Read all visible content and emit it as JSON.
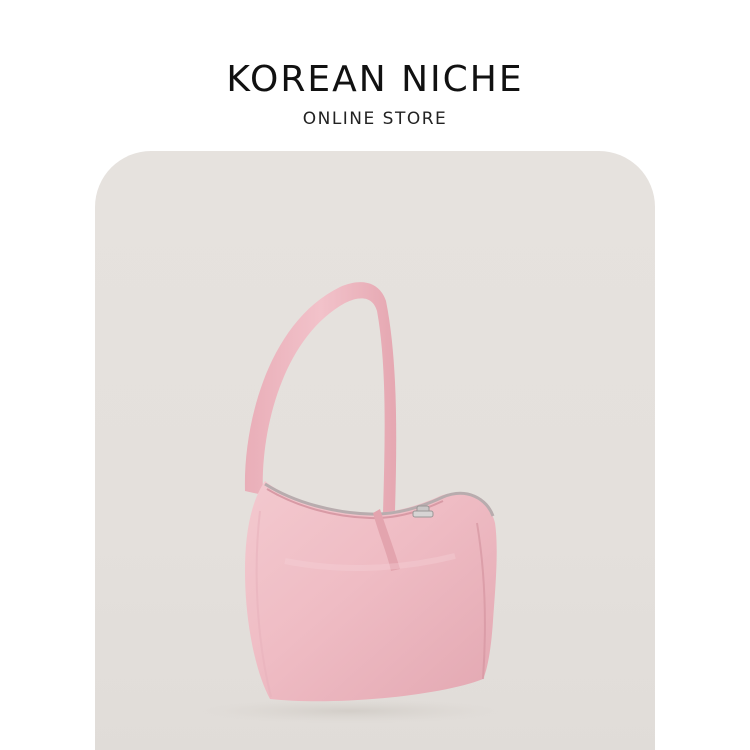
{
  "header": {
    "title": "KOREAN NICHE",
    "subtitle": "ONLINE STORE"
  },
  "product": {
    "image_icon": "pink-shoulder-bag-image",
    "bag_color": "#efbcc4",
    "background_color": "#e4e0dc"
  }
}
